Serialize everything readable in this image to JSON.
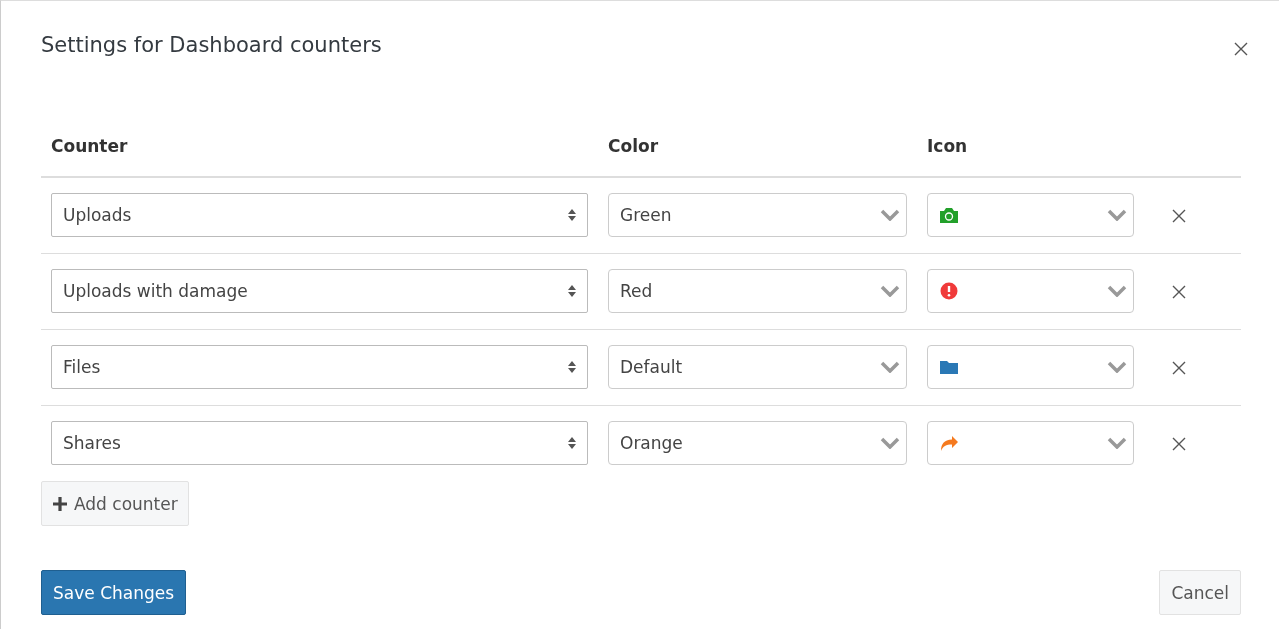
{
  "dialog": {
    "title": "Settings for Dashboard counters"
  },
  "table": {
    "columns": [
      "Counter",
      "Color",
      "Icon"
    ],
    "rows": [
      {
        "counter": "Uploads",
        "color_name": "Green",
        "kind": "camera",
        "color": "#22a02a"
      },
      {
        "counter": "Uploads with damage",
        "color_name": "Red",
        "kind": "alert",
        "color": "#f03a3a"
      },
      {
        "counter": "Files",
        "color_name": "Default",
        "kind": "folder",
        "color": "#2a78b5"
      },
      {
        "counter": "Shares",
        "color_name": "Orange",
        "kind": "share",
        "color": "#f57a1f"
      }
    ]
  },
  "add_button": {
    "label": "Add counter"
  },
  "footer": {
    "save": "Save Changes",
    "cancel": "Cancel"
  }
}
